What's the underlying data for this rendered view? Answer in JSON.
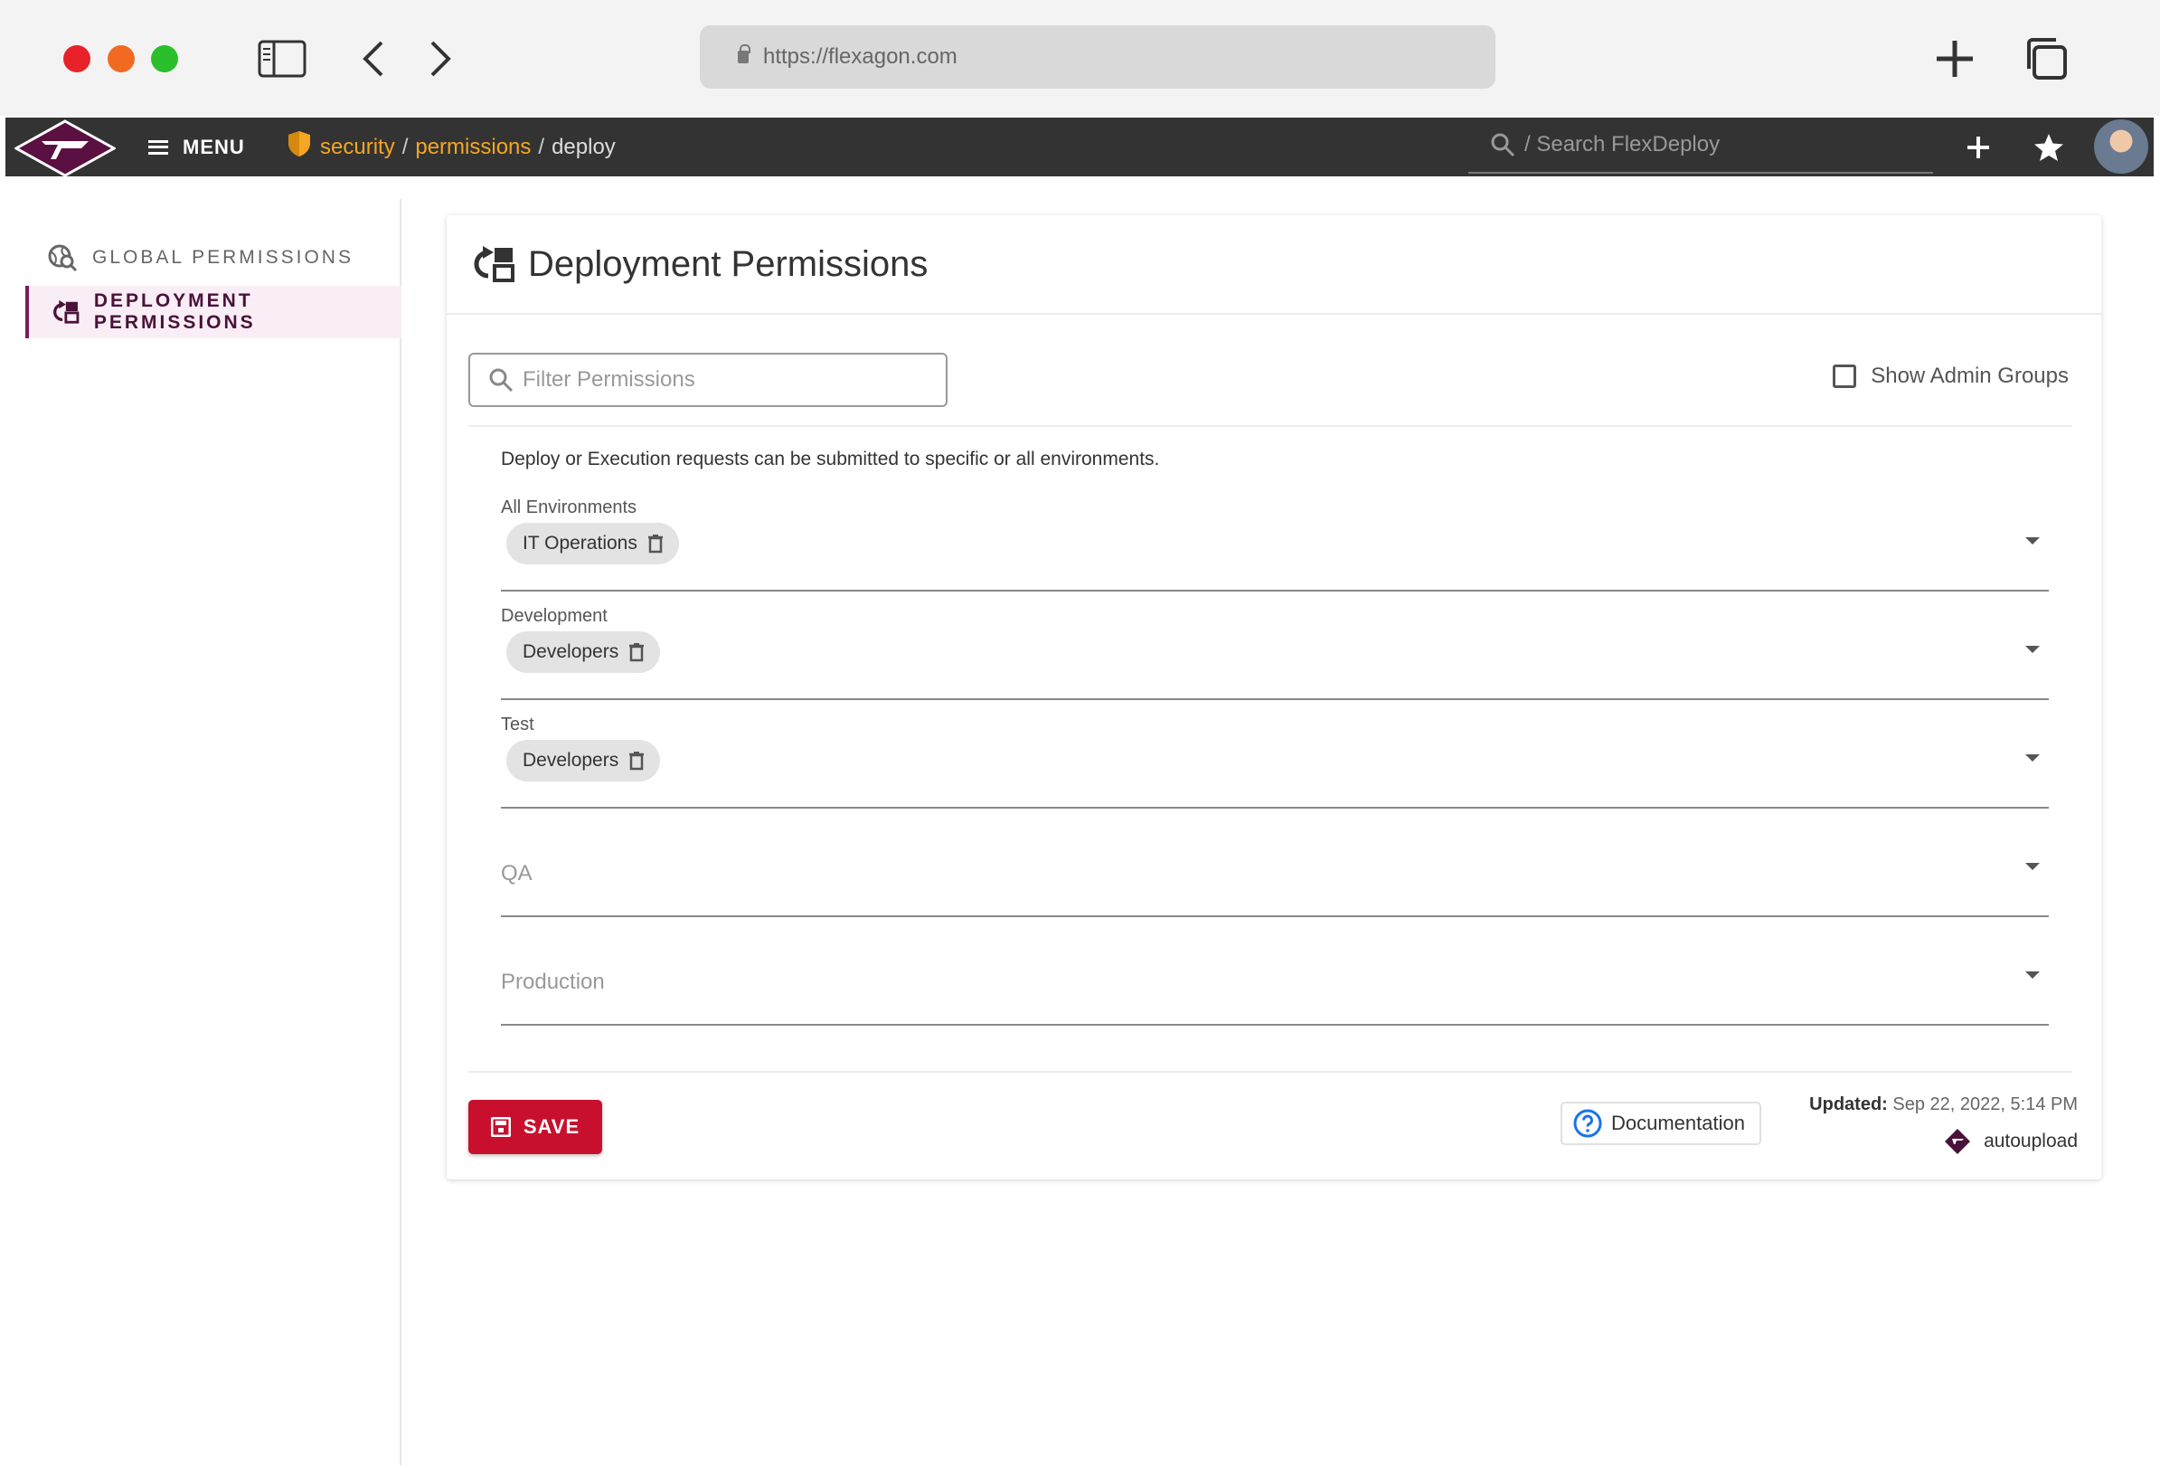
{
  "browser": {
    "url": "https://flexagon.com"
  },
  "header": {
    "menu_label": "MENU",
    "breadcrumb": {
      "security": "security",
      "permissions": "permissions",
      "current": "deploy",
      "separator": "/"
    },
    "search_placeholder": "/ Search FlexDeploy"
  },
  "sidebar": {
    "items": [
      {
        "label": "GLOBAL PERMISSIONS",
        "active": false
      },
      {
        "label": "DEPLOYMENT PERMISSIONS",
        "active": true
      }
    ]
  },
  "panel": {
    "title": "Deployment Permissions",
    "filter_placeholder": "Filter Permissions",
    "show_admin_groups_label": "Show Admin Groups",
    "show_admin_groups_checked": false,
    "intro": "Deploy or Execution requests can be submitted to specific or all environments.",
    "environments": [
      {
        "name": "All Environments",
        "groups": [
          "IT Operations"
        ]
      },
      {
        "name": "Development",
        "groups": [
          "Developers"
        ]
      },
      {
        "name": "Test",
        "groups": [
          "Developers"
        ]
      },
      {
        "name": "QA",
        "groups": []
      },
      {
        "name": "Production",
        "groups": []
      }
    ],
    "save_label": "SAVE",
    "documentation_label": "Documentation",
    "updated_label": "Updated:",
    "updated_value": "Sep 22, 2022, 5:14 PM",
    "updated_by": "autoupload"
  },
  "colors": {
    "accent": "#c8102e",
    "brand": "#7b1b5c",
    "breadcrumb_link": "#f5a623",
    "header_bg": "#333333"
  }
}
